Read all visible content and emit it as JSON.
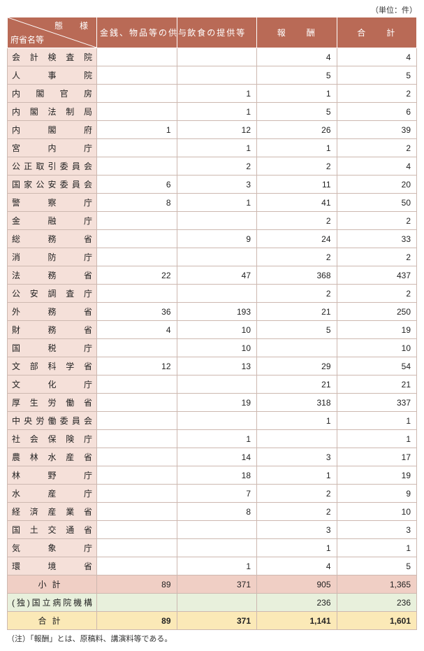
{
  "unit": "（単位：件）",
  "header": {
    "corner_top": "態　様",
    "corner_bottom": "府省名等",
    "cols": [
      "金銭、物品等の供与",
      "飲食の提供等",
      "報　　酬",
      "合　　計"
    ]
  },
  "chart_data": {
    "type": "table",
    "columns": [
      "府省名等",
      "金銭、物品等の供与",
      "飲食の提供等",
      "報酬",
      "合計"
    ],
    "rows": [
      {
        "name": "会計検査院",
        "v": [
          "",
          "",
          "4",
          "4"
        ]
      },
      {
        "name": "人事院",
        "v": [
          "",
          "",
          "5",
          "5"
        ]
      },
      {
        "name": "内閣官房",
        "v": [
          "",
          "1",
          "1",
          "2"
        ]
      },
      {
        "name": "内閣法制局",
        "v": [
          "",
          "1",
          "5",
          "6"
        ]
      },
      {
        "name": "内閣府",
        "v": [
          "1",
          "12",
          "26",
          "39"
        ]
      },
      {
        "name": "宮内庁",
        "v": [
          "",
          "1",
          "1",
          "2"
        ]
      },
      {
        "name": "公正取引委員会",
        "v": [
          "",
          "2",
          "2",
          "4"
        ]
      },
      {
        "name": "国家公安委員会",
        "v": [
          "6",
          "3",
          "11",
          "20"
        ]
      },
      {
        "name": "警察庁",
        "v": [
          "8",
          "1",
          "41",
          "50"
        ]
      },
      {
        "name": "金融庁",
        "v": [
          "",
          "",
          "2",
          "2"
        ]
      },
      {
        "name": "総務省",
        "v": [
          "",
          "9",
          "24",
          "33"
        ]
      },
      {
        "name": "消防庁",
        "v": [
          "",
          "",
          "2",
          "2"
        ]
      },
      {
        "name": "法務省",
        "v": [
          "22",
          "47",
          "368",
          "437"
        ]
      },
      {
        "name": "公安調査庁",
        "v": [
          "",
          "",
          "2",
          "2"
        ]
      },
      {
        "name": "外務省",
        "v": [
          "36",
          "193",
          "21",
          "250"
        ]
      },
      {
        "name": "財務省",
        "v": [
          "4",
          "10",
          "5",
          "19"
        ]
      },
      {
        "name": "国税庁",
        "v": [
          "",
          "10",
          "",
          "10"
        ]
      },
      {
        "name": "文部科学省",
        "v": [
          "12",
          "13",
          "29",
          "54"
        ]
      },
      {
        "name": "文化庁",
        "v": [
          "",
          "",
          "21",
          "21"
        ]
      },
      {
        "name": "厚生労働省",
        "v": [
          "",
          "19",
          "318",
          "337"
        ]
      },
      {
        "name": "中央労働委員会",
        "v": [
          "",
          "",
          "1",
          "1"
        ]
      },
      {
        "name": "社会保険庁",
        "v": [
          "",
          "1",
          "",
          "1"
        ]
      },
      {
        "name": "農林水産省",
        "v": [
          "",
          "14",
          "3",
          "17"
        ]
      },
      {
        "name": "林野庁",
        "v": [
          "",
          "18",
          "1",
          "19"
        ]
      },
      {
        "name": "水産庁",
        "v": [
          "",
          "7",
          "2",
          "9"
        ]
      },
      {
        "name": "経済産業省",
        "v": [
          "",
          "8",
          "2",
          "10"
        ]
      },
      {
        "name": "国土交通省",
        "v": [
          "",
          "",
          "3",
          "3"
        ]
      },
      {
        "name": "気象庁",
        "v": [
          "",
          "",
          "1",
          "1"
        ]
      },
      {
        "name": "環境省",
        "v": [
          "",
          "1",
          "4",
          "5"
        ]
      }
    ],
    "subtotal": {
      "name": "小計",
      "v": [
        "89",
        "371",
        "905",
        "1,365"
      ]
    },
    "independent": {
      "name": "(独)国立病院機構",
      "v": [
        "",
        "",
        "236",
        "236"
      ]
    },
    "total": {
      "name": "合計",
      "v": [
        "89",
        "371",
        "1,141",
        "1,601"
      ]
    }
  },
  "note": "（注）「報酬」とは、原稿料、講演料等である。"
}
